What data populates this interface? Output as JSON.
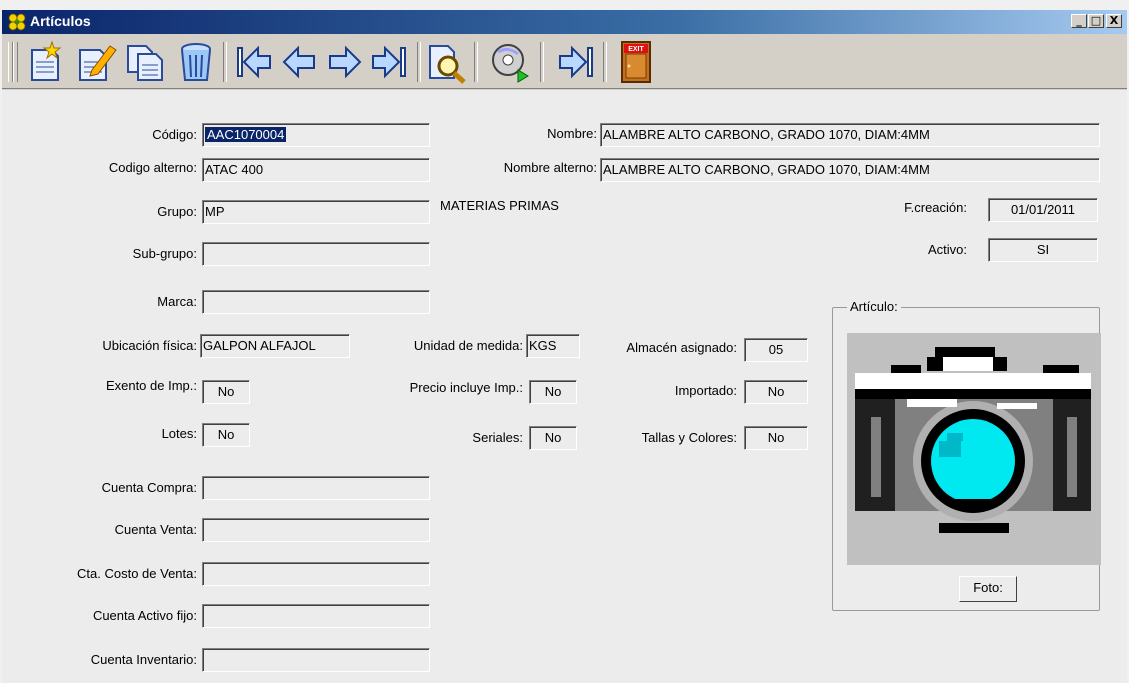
{
  "window": {
    "title": "Artículos",
    "controls": [
      "_",
      "□",
      "X"
    ]
  },
  "toolbar": {
    "buttons": [
      {
        "name": "new-icon"
      },
      {
        "name": "edit-icon"
      },
      {
        "name": "copy-icon"
      },
      {
        "name": "delete-icon"
      },
      {
        "name": "first-record-icon"
      },
      {
        "name": "previous-record-icon"
      },
      {
        "name": "next-record-icon"
      },
      {
        "name": "last-record-icon"
      },
      {
        "name": "search-icon"
      },
      {
        "name": "multimedia-icon"
      },
      {
        "name": "goto-icon"
      },
      {
        "name": "exit-icon"
      }
    ],
    "exit_label": "EXIT"
  },
  "form": {
    "codigo": {
      "label": "Código:",
      "value": "AAC1070004"
    },
    "nombre": {
      "label": "Nombre:",
      "value": "ALAMBRE ALTO CARBONO, GRADO 1070, DIAM:4MM"
    },
    "codigo_alterno": {
      "label": "Codigo alterno:",
      "value": "ATAC 400"
    },
    "nombre_alterno": {
      "label": "Nombre alterno:",
      "value": "ALAMBRE ALTO CARBONO, GRADO 1070, DIAM:4MM"
    },
    "grupo": {
      "label": "Grupo:",
      "value": "MP",
      "description": "MATERIAS PRIMAS"
    },
    "f_creacion": {
      "label": "F.creación:",
      "value": "01/01/2011"
    },
    "sub_grupo": {
      "label": "Sub-grupo:",
      "value": ""
    },
    "activo": {
      "label": "Activo:",
      "value": "SI"
    },
    "marca": {
      "label": "Marca:",
      "value": ""
    },
    "ubicacion": {
      "label": "Ubicación física:",
      "value": "GALPON ALFAJOL"
    },
    "unidad": {
      "label": "Unidad de medida:",
      "value": "KGS"
    },
    "almacen": {
      "label": "Almacén asignado:",
      "value": "05"
    },
    "exento": {
      "label": "Exento de Imp.:",
      "value": "No"
    },
    "precio_incluye": {
      "label": "Precio incluye Imp.:",
      "value": "No"
    },
    "importado": {
      "label": "Importado:",
      "value": "No"
    },
    "lotes": {
      "label": "Lotes:",
      "value": "No"
    },
    "seriales": {
      "label": "Seriales:",
      "value": "No"
    },
    "tallas": {
      "label": "Tallas y Colores:",
      "value": "No"
    },
    "cuenta_compra": {
      "label": "Cuenta Compra:",
      "value": ""
    },
    "cuenta_venta": {
      "label": "Cuenta Venta:",
      "value": ""
    },
    "cta_costo": {
      "label": "Cta. Costo de Venta:",
      "value": ""
    },
    "cuenta_activo": {
      "label": "Cuenta Activo fijo:",
      "value": ""
    },
    "cuenta_inventario": {
      "label": "Cuenta Inventario:",
      "value": ""
    }
  },
  "photo": {
    "group_title": "Artículo:",
    "button_label": "Foto:",
    "image_name": "camera-placeholder-icon"
  }
}
